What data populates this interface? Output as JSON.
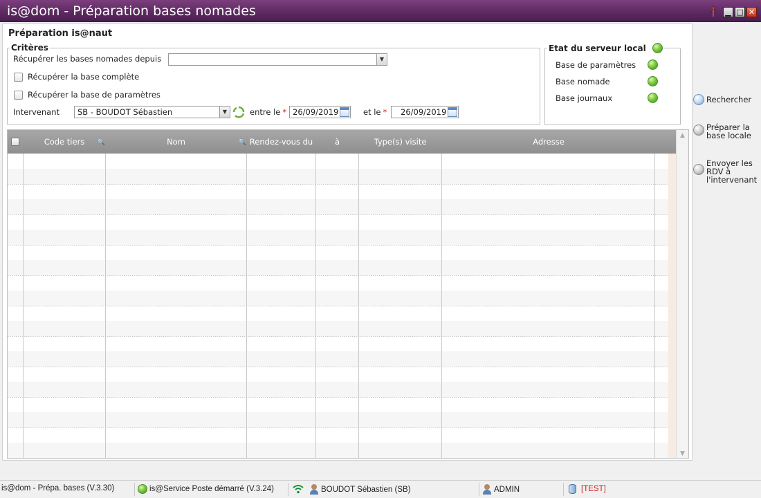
{
  "window": {
    "title": "is@dom - Préparation bases nomades"
  },
  "page": {
    "title": "Préparation is@naut"
  },
  "criteria": {
    "legend": "Critères",
    "fetch_since_label": "Récupérer les bases nomades depuis",
    "fetch_since_value": "",
    "full_base_label": "Récupérer la base complète",
    "param_base_label": "Récupérer la base de paramètres",
    "intervenant_label": "Intervenant",
    "intervenant_value": "SB - BOUDOT Sébastien",
    "between_label": "entre le",
    "and_label": "et le",
    "date_from": "26/09/2019",
    "date_to": "26/09/2019",
    "required_mark": "*"
  },
  "server": {
    "legend": "Etat du serveur local",
    "items": [
      {
        "label": "Base de paramètres",
        "status": "ok"
      },
      {
        "label": "Base nomade",
        "status": "ok"
      },
      {
        "label": "Base journaux",
        "status": "ok"
      }
    ],
    "status_color": "#7ccb3c"
  },
  "grid": {
    "columns": [
      "Code tiers",
      "Nom",
      "Rendez-vous du",
      "à",
      "Type(s) visite",
      "Adresse"
    ],
    "rows": []
  },
  "actions": {
    "search": "Rechercher",
    "prepare": "Préparer la\nbase locale",
    "send": "Envoyer les\nRDV à\nl'intervenant"
  },
  "statusbar": {
    "app": "is@dom - Prépa. bases (V.3.30)",
    "service": "is@Service Poste démarré (V.3.24)",
    "user": "BOUDOT Sébastien (SB)",
    "role": "ADMIN",
    "env": "[TEST]"
  },
  "colors": {
    "titlebar": "#5e2a62",
    "grid_header": "#999999",
    "test": "#d21e1e"
  }
}
